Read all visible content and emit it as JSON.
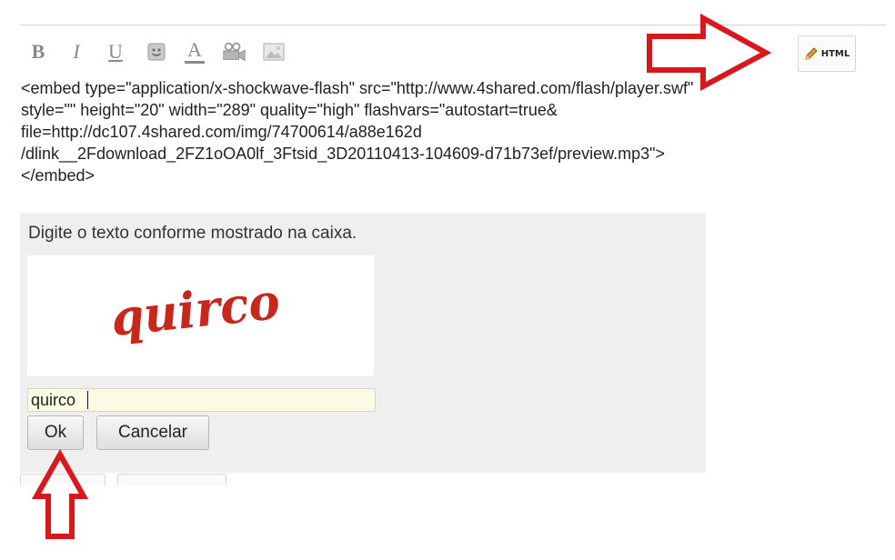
{
  "toolbar": {
    "bold_label": "B",
    "italic_label": "I",
    "underline_label": "U",
    "text_color_label": "A",
    "html_label": "HTML"
  },
  "code_text": "<embed type=\"application/x-shockwave-flash\" src=\"http://www.4shared.com/flash/player.swf\"\nstyle=\"\" height=\"20\" width=\"289\" quality=\"high\" flashvars=\"autostart=true&\nfile=http://dc107.4shared.com/img/74700614/a88e162d\n/dlink__2Fdownload_2FZ1oOA0lf_3Ftsid_3D20110413-104609-d71b73ef/preview.mp3\">\n</embed>",
  "captcha": {
    "prompt": "Digite o texto conforme mostrado na caixa.",
    "image_text": "quirco",
    "input_value": "quirco",
    "ok_label": "Ok",
    "cancel_label": "Cancelar"
  },
  "colors": {
    "annotation_arrow": "#d8181c",
    "captcha_text": "#c8281c",
    "panel_background": "#efefef"
  },
  "icons": [
    "smiley-icon",
    "text-color-icon",
    "video-icon",
    "image-icon",
    "pencil-icon",
    "right-arrow-annotation",
    "up-arrow-annotation"
  ]
}
